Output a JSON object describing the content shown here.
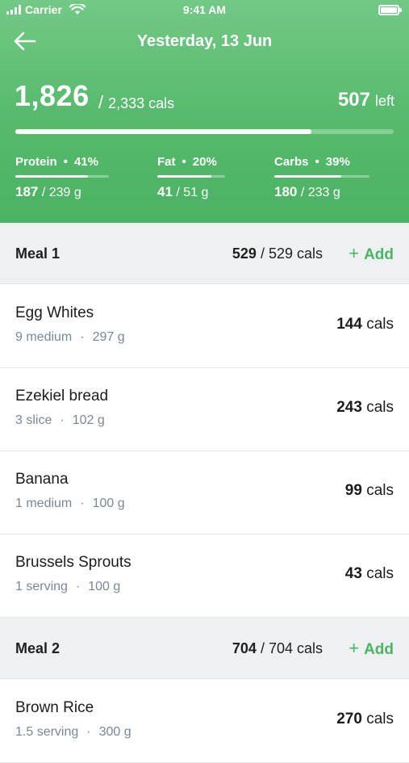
{
  "status_bar": {
    "carrier": "Carrier",
    "time": "9:41 AM"
  },
  "header": {
    "title": "Yesterday, 13 Jun",
    "consumed": "1,826",
    "goal": "2,333 cals",
    "left_value": "507",
    "left_word": "left",
    "progress_fraction": 0.783
  },
  "macros": [
    {
      "name": "Protein",
      "percent": "41%",
      "amount": "187",
      "goal": "239 g",
      "fill": 0.78
    },
    {
      "name": "Fat",
      "percent": "20%",
      "amount": "41",
      "goal": "51 g",
      "fill": 0.8
    },
    {
      "name": "Carbs",
      "percent": "39%",
      "amount": "180",
      "goal": "233 g",
      "fill": 0.7
    }
  ],
  "meals": [
    {
      "title": "Meal 1",
      "cals": "529",
      "goal": "529 cals",
      "add_label": "Add",
      "foods": [
        {
          "name": "Egg Whites",
          "qty": "9 medium",
          "weight": "297 g",
          "cals": "144",
          "unit": "cals"
        },
        {
          "name": "Ezekiel bread",
          "qty": "3 slice",
          "weight": "102 g",
          "cals": "243",
          "unit": "cals"
        },
        {
          "name": "Banana",
          "qty": "1 medium",
          "weight": "100 g",
          "cals": "99",
          "unit": "cals"
        },
        {
          "name": "Brussels Sprouts",
          "qty": "1 serving",
          "weight": "100 g",
          "cals": "43",
          "unit": "cals"
        }
      ]
    },
    {
      "title": "Meal 2",
      "cals": "704",
      "goal": "704 cals",
      "add_label": "Add",
      "foods": [
        {
          "name": "Brown Rice",
          "qty": "1.5 serving",
          "weight": "300 g",
          "cals": "270",
          "unit": "cals"
        }
      ]
    }
  ],
  "colors": {
    "header_green": "#56b96c",
    "accent_green": "#49b565",
    "meal_header_bg": "#eef1f2",
    "detail_gray": "#7c8794"
  },
  "icons": {
    "back": "arrow-left-icon",
    "wifi": "wifi-icon",
    "signal": "signal-bars-icon",
    "battery": "battery-icon"
  }
}
